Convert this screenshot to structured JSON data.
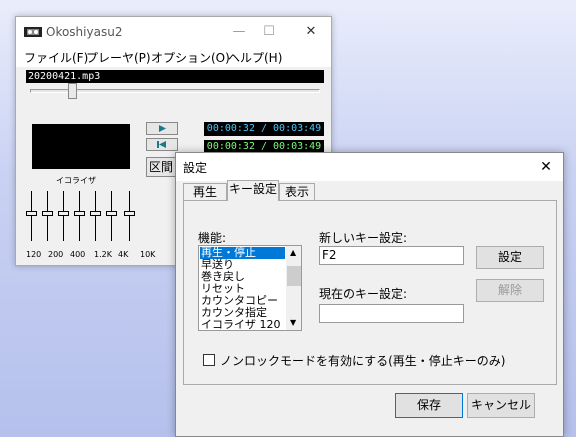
{
  "main_window": {
    "title": "Okoshiyasu2",
    "menu": [
      "ファイル(F)",
      "プレーヤ(P)",
      "オプション(O)",
      "ヘルプ(H)"
    ],
    "filename": "20200421.mp3",
    "seek_fraction": 0.14,
    "time1": "00:00:32 / 00:03:49",
    "time2": "00:00:32 / 00:03:49",
    "time1_color": "#4fc3f7",
    "time2_color": "#7fff7f",
    "section_button": "区間",
    "equalizer_label": "イコライザ",
    "eq_bands": [
      "120",
      "200",
      "400",
      "1.2K",
      "4K",
      "10K"
    ],
    "eq_levels": [
      0.5,
      0.5,
      0.5,
      0.5,
      0.5,
      0.5
    ]
  },
  "dialog": {
    "title": "設定",
    "tabs": [
      "再生",
      "キー設定",
      "表示"
    ],
    "active_tab": "キー設定",
    "function_label": "機能:",
    "functions": [
      "再生・停止",
      "早送り",
      "巻き戻し",
      "リセット",
      "カウンタコピー",
      "カウンタ指定",
      "イコライザ 120"
    ],
    "selected_function": "再生・停止",
    "new_key_label": "新しいキー設定:",
    "new_key_value": "F2",
    "set_button": "設定",
    "current_key_label": "現在のキー設定:",
    "current_key_value": "",
    "release_button": "解除",
    "nonlock_label": "ノンロックモードを有効にする(再生・停止キーのみ)",
    "nonlock_checked": false,
    "save_button": "保存",
    "cancel_button": "キャンセル"
  }
}
